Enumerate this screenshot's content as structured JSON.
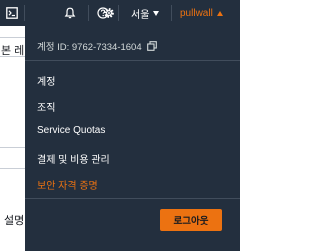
{
  "background": {
    "fragment_1": "본 레이",
    "fragment_2": "설명"
  },
  "topbar": {
    "icons": [
      "terminal-icon",
      "bell-icon",
      "help-icon",
      "gear-icon"
    ],
    "region_label": "서울",
    "user_label": "pullwall"
  },
  "account_menu": {
    "account_id_label": "계정 ID: 9762-7334-1604",
    "items": [
      {
        "label": "계정"
      },
      {
        "label": "조직"
      },
      {
        "label": "Service Quotas"
      },
      {
        "label": "결제 및 비용 관리"
      },
      {
        "label": "보안 자격 증명",
        "accent": true
      }
    ],
    "logout_label": "로그아웃"
  },
  "colors": {
    "nav_background": "#232f3e",
    "accent": "#ec7211",
    "divider": "#414d5c"
  }
}
